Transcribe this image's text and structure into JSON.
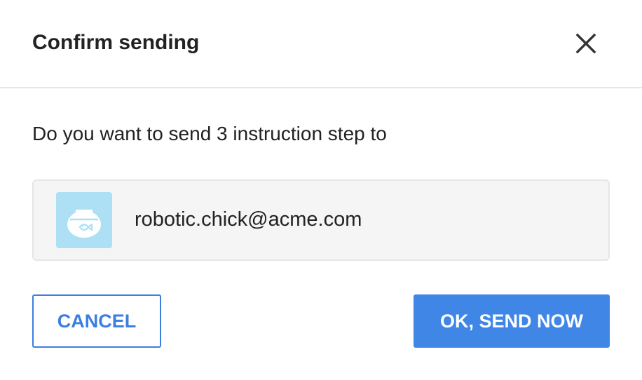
{
  "dialog": {
    "title": "Confirm sending",
    "close_icon": "close-icon",
    "message": "Do you want to send 3 instruction step to",
    "recipient": {
      "avatar_icon": "fishbowl-avatar-icon",
      "email": "robotic.chick@acme.com"
    },
    "cancel_label": "CANCEL",
    "confirm_label": "OK, SEND NOW"
  },
  "colors": {
    "accent": "#3f86e6",
    "avatar_bg": "#ade0f5",
    "recipient_bg": "#f5f5f5",
    "divider": "#e6e6e6",
    "text": "#222222"
  }
}
